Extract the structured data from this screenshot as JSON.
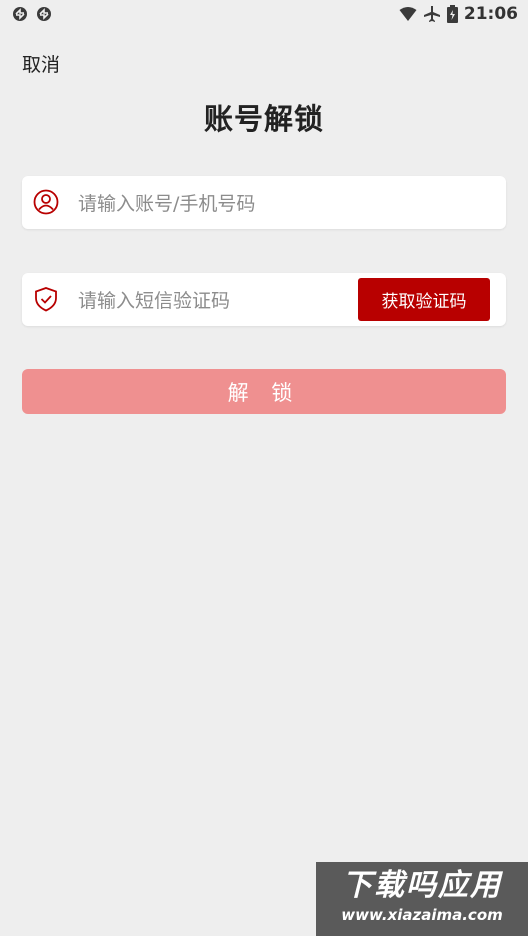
{
  "status_bar": {
    "time": "21:06",
    "icons": [
      "sync-icon",
      "sync-icon",
      "wifi-icon",
      "airplane-icon",
      "battery-icon"
    ]
  },
  "header": {
    "cancel_label": "取消",
    "title": "账号解锁"
  },
  "form": {
    "account": {
      "icon": "user-icon",
      "placeholder": "请输入账号/手机号码",
      "value": ""
    },
    "code": {
      "icon": "shield-check-icon",
      "placeholder": "请输入短信验证码",
      "value": "",
      "button_label": "获取验证码"
    },
    "submit_label": "解 锁"
  },
  "colors": {
    "accent": "#b80000",
    "submit_disabled": "#ef9090",
    "background": "#eeeeee"
  },
  "watermark": {
    "title": "下载吗应用",
    "url": "www.xiazaima.com"
  }
}
